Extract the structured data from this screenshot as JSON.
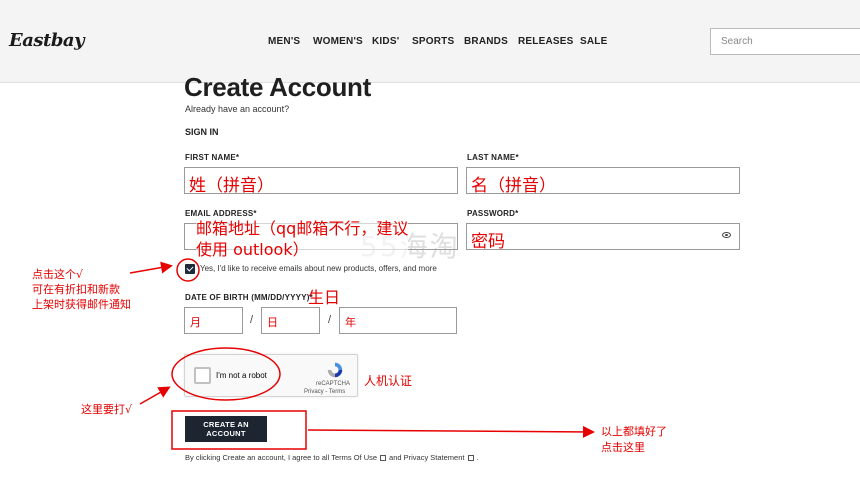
{
  "header": {
    "logo_text": "Eastbay",
    "nav": [
      "MEN'S",
      "WOMEN'S",
      "KIDS'",
      "SPORTS",
      "BRANDS",
      "RELEASES",
      "SALE"
    ],
    "search_placeholder": "Search"
  },
  "form": {
    "title": "Create Account",
    "already": "Already have an account?",
    "sign_in": "SIGN IN",
    "first_name_label": "FIRST NAME*",
    "first_name_value": "姓（拼音）",
    "last_name_label": "LAST NAME*",
    "last_name_value": "名（拼音）",
    "email_label": "EMAIL ADDRESS*",
    "password_label": "PASSWORD*",
    "password_value": "密码",
    "consent": "Yes, I'd like to receive emails about new products, offers, and more",
    "dob_label": "DATE OF BIRTH (MM/DD/YYYY)*",
    "dob_month": "月",
    "dob_day": "日",
    "dob_year": "年",
    "slash": "/",
    "recaptcha_label": "I'm not a robot",
    "recaptcha_brand": "reCAPTCHA",
    "recaptcha_terms": "Privacy - Terms",
    "create_button": "CREATE AN ACCOUNT",
    "terms_prefix": "By clicking Create an account, I agree to all Terms Of Use",
    "terms_middle": "and Privacy Statement",
    "terms_suffix": "."
  },
  "annotations": {
    "email_line1": "邮箱地址（qq邮箱不行，建议",
    "email_line2": "使用 outlook）",
    "dob": "生日",
    "checkbox_line1": "点击这个√",
    "checkbox_line2": "可在有折扣和新款",
    "checkbox_line3": "上架时获得邮件通知",
    "robot": "人机认证",
    "captcha_tip": "这里要打√",
    "submit_line1": "以上都填好了",
    "submit_line2": "点击这里",
    "watermark": "55海淘"
  },
  "colors": {
    "annotation": "#e60000",
    "button": "#1c2530",
    "header_bg": "#f4f4f4"
  }
}
